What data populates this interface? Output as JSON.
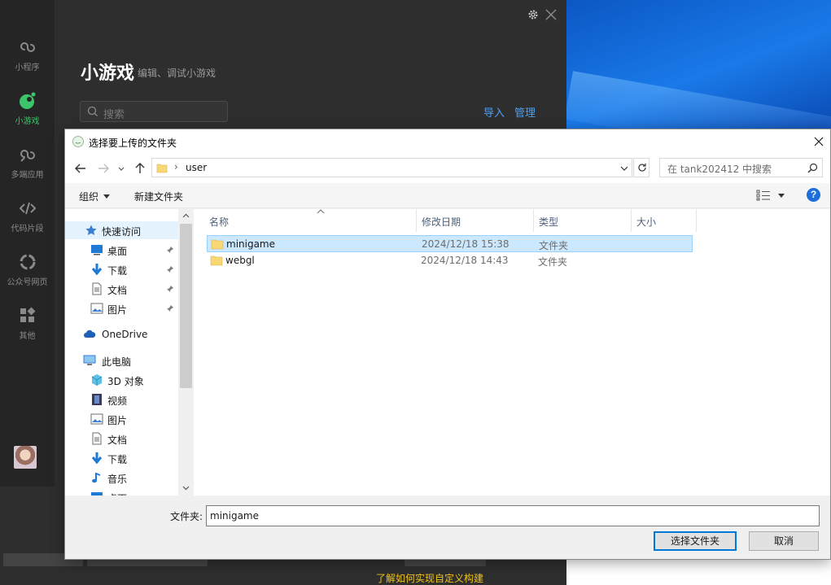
{
  "app": {
    "sidebar": [
      {
        "label": "小程序",
        "icon": "miniprogram-icon",
        "active": false
      },
      {
        "label": "小游戏",
        "icon": "minigame-icon",
        "active": true
      },
      {
        "label": "多端应用",
        "icon": "multiplatform-icon",
        "active": false
      },
      {
        "label": "代码片段",
        "icon": "code-snippet-icon",
        "active": false
      },
      {
        "label": "公众号网页",
        "icon": "official-account-icon",
        "active": false
      },
      {
        "label": "其他",
        "icon": "grid-icon",
        "active": false
      }
    ],
    "title": "小游戏",
    "subtitle": "编辑、调试小游戏",
    "search_placeholder": "搜索",
    "import_label": "导入",
    "manage_label": "管理",
    "bottom_link": "了解如何实现自定义构建",
    "accent_color": "#3cc46a",
    "link_color": "#4ea0f0"
  },
  "dialog": {
    "title": "选择要上传的文件夹",
    "address": {
      "separator": "›",
      "path": "user"
    },
    "search_placeholder": "在 tank202412 中搜索",
    "toolbar": {
      "organize_label": "组织",
      "new_folder_label": "新建文件夹",
      "help_label": "?"
    },
    "nav": {
      "quick_access": "快速访问",
      "quick_items": [
        "桌面",
        "下载",
        "文档",
        "图片"
      ],
      "onedrive": "OneDrive",
      "this_pc": "此电脑",
      "pc_items": [
        "3D 对象",
        "视频",
        "图片",
        "文档",
        "下载",
        "音乐",
        "桌面"
      ]
    },
    "columns": [
      "名称",
      "修改日期",
      "类型",
      "大小"
    ],
    "files": [
      {
        "name": "minigame",
        "date": "2024/12/18 15:38",
        "type": "文件夹",
        "size": "",
        "selected": true
      },
      {
        "name": "webgl",
        "date": "2024/12/18 14:43",
        "type": "文件夹",
        "size": "",
        "selected": false
      }
    ],
    "footer": {
      "filename_label": "文件夹:",
      "filename_value": "minigame",
      "select_label": "选择文件夹",
      "cancel_label": "取消"
    }
  }
}
